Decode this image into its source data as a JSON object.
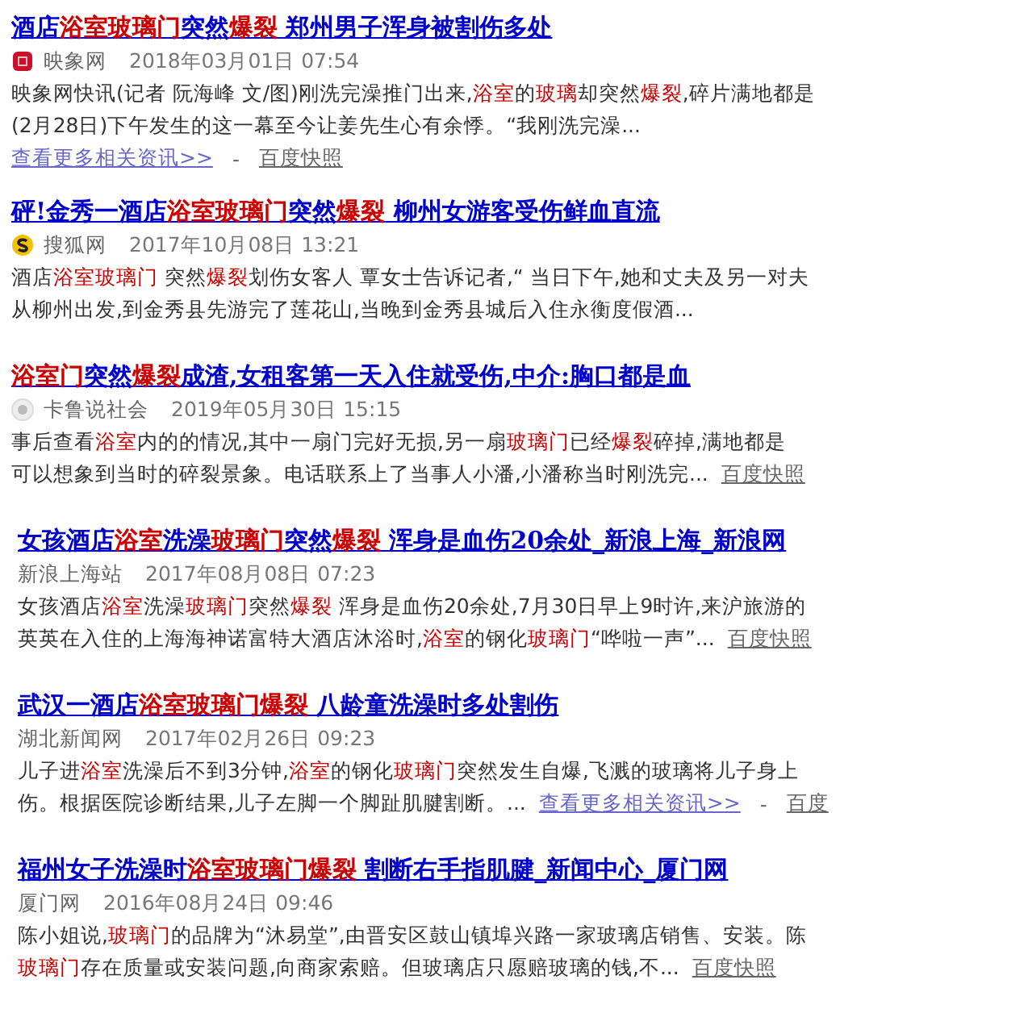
{
  "results": [
    {
      "title": [
        {
          "text": "酒店",
          "highlight": false
        },
        {
          "text": "浴室玻璃门",
          "highlight": true
        },
        {
          "text": "突然",
          "highlight": false
        },
        {
          "text": "爆裂",
          "highlight": true
        },
        {
          "text": " 郑州男子浑身被割伤多处",
          "highlight": false
        }
      ],
      "logo": {
        "kind": "square"
      },
      "source": "映象网",
      "date": "2018年03月01日 07:54",
      "lines": [
        {
          "segments": [
            {
              "text": "映象网快讯(记者 阮海峰 文/图)刚洗完澡推门出来,",
              "highlight": false
            },
            {
              "text": "浴室",
              "highlight": true
            },
            {
              "text": "的",
              "highlight": false
            },
            {
              "text": "玻璃",
              "highlight": true
            },
            {
              "text": "却突然",
              "highlight": false
            },
            {
              "text": "爆裂",
              "highlight": true
            },
            {
              "text": ",碎片满地都是",
              "highlight": false
            }
          ]
        },
        {
          "segments": [
            {
              "text": "(2月28日)下午发生的这一幕至今让姜先生心有余悸。“我刚洗完澡...",
              "highlight": false
            }
          ]
        },
        {
          "links": [
            {
              "kind": "more",
              "text": "查看更多相关资讯>>"
            },
            {
              "kind": "sep",
              "text": "-"
            },
            {
              "kind": "cache",
              "text": "百度快照"
            }
          ]
        }
      ]
    },
    {
      "title": [
        {
          "text": "砰!金秀一酒店",
          "highlight": false
        },
        {
          "text": "浴室玻璃门",
          "highlight": true
        },
        {
          "text": "突然",
          "highlight": false
        },
        {
          "text": "爆裂",
          "highlight": true
        },
        {
          "text": " 柳州女游客受伤鲜血直流",
          "highlight": false
        }
      ],
      "logo": {
        "kind": "swirl"
      },
      "source": "搜狐网",
      "date": "2017年10月08日 13:21",
      "lines": [
        {
          "segments": [
            {
              "text": "酒店",
              "highlight": false
            },
            {
              "text": "浴室玻璃门",
              "highlight": true
            },
            {
              "text": " 突然",
              "highlight": false
            },
            {
              "text": "爆裂",
              "highlight": true
            },
            {
              "text": "划伤女客人 覃女士告诉记者,“ 当日下午,她和丈夫及另一对夫",
              "highlight": false
            }
          ]
        },
        {
          "segments": [
            {
              "text": "从柳州出发,到金秀县先游完了莲花山,当晚到金秀县城后入住永衡度假酒...",
              "highlight": false
            }
          ]
        }
      ]
    },
    {
      "title": [
        {
          "text": "浴室门",
          "highlight": true
        },
        {
          "text": "突然",
          "highlight": false
        },
        {
          "text": "爆裂",
          "highlight": true
        },
        {
          "text": "成渣,女租客第一天入住就受伤,中介:胸口都是血",
          "highlight": false
        }
      ],
      "logo": {
        "kind": "dot"
      },
      "source": "卡鲁说社会",
      "date": "2019年05月30日 15:15",
      "lines": [
        {
          "segments": [
            {
              "text": "事后查看",
              "highlight": false
            },
            {
              "text": "浴室",
              "highlight": true
            },
            {
              "text": "内的的情况,其中一扇门完好无损,另一扇",
              "highlight": false
            },
            {
              "text": "玻璃门",
              "highlight": true
            },
            {
              "text": "已经",
              "highlight": false
            },
            {
              "text": "爆裂",
              "highlight": true
            },
            {
              "text": "碎掉,满地都是",
              "highlight": false
            }
          ]
        },
        {
          "segments": [
            {
              "text": "可以想象到当时的碎裂景象。电话联系上了当事人小潘,小潘称当时刚洗完...",
              "highlight": false
            }
          ],
          "links": [
            {
              "kind": "cache",
              "text": "百度快照"
            }
          ]
        }
      ]
    },
    {
      "title": [
        {
          "text": "女孩酒店",
          "highlight": false
        },
        {
          "text": "浴室",
          "highlight": true
        },
        {
          "text": "洗澡",
          "highlight": false
        },
        {
          "text": "玻璃门",
          "highlight": true
        },
        {
          "text": "突然",
          "highlight": false
        },
        {
          "text": "爆裂",
          "highlight": true
        },
        {
          "text": " 浑身是血伤20余处_新浪上海_新浪网",
          "highlight": false
        }
      ],
      "source": "新浪上海站",
      "date": "2017年08月08日 07:23",
      "lines": [
        {
          "segments": [
            {
              "text": "女孩酒店",
              "highlight": false
            },
            {
              "text": "浴室",
              "highlight": true
            },
            {
              "text": "洗澡",
              "highlight": false
            },
            {
              "text": "玻璃门",
              "highlight": true
            },
            {
              "text": "突然",
              "highlight": false
            },
            {
              "text": "爆裂",
              "highlight": true
            },
            {
              "text": " 浑身是血伤20余处,7月30日早上9时许,来沪旅游的",
              "highlight": false
            }
          ]
        },
        {
          "segments": [
            {
              "text": "英英在入住的上海海神诺富特大酒店沐浴时,",
              "highlight": false
            },
            {
              "text": "浴室",
              "highlight": true
            },
            {
              "text": "的钢化",
              "highlight": false
            },
            {
              "text": "玻璃门",
              "highlight": true
            },
            {
              "text": "“哗啦一声”...",
              "highlight": false
            }
          ],
          "links": [
            {
              "kind": "cache",
              "text": "百度快照"
            }
          ]
        }
      ]
    },
    {
      "title": [
        {
          "text": "武汉一酒店",
          "highlight": false
        },
        {
          "text": "浴室玻璃门爆裂",
          "highlight": true
        },
        {
          "text": " 八龄童洗澡时多处割伤",
          "highlight": false
        }
      ],
      "source": "湖北新闻网",
      "date": "2017年02月26日 09:23",
      "lines": [
        {
          "segments": [
            {
              "text": "儿子进",
              "highlight": false
            },
            {
              "text": "浴室",
              "highlight": true
            },
            {
              "text": "洗澡后不到3分钟,",
              "highlight": false
            },
            {
              "text": "浴室",
              "highlight": true
            },
            {
              "text": "的钢化",
              "highlight": false
            },
            {
              "text": "玻璃门",
              "highlight": true
            },
            {
              "text": "突然发生自爆,飞溅的玻璃将儿子身上",
              "highlight": false
            }
          ]
        },
        {
          "segments": [
            {
              "text": "伤。根据医院诊断结果,儿子左脚一个脚趾肌腱割断。...",
              "highlight": false
            }
          ],
          "links": [
            {
              "kind": "more",
              "text": "查看更多相关资讯>>"
            },
            {
              "kind": "sep",
              "text": "-"
            },
            {
              "kind": "cache",
              "text": "百度"
            }
          ]
        }
      ]
    },
    {
      "title": [
        {
          "text": "福州女子洗澡时",
          "highlight": false
        },
        {
          "text": "浴室玻璃门爆裂",
          "highlight": true
        },
        {
          "text": " 割断右手指肌腱_新闻中心_厦门网",
          "highlight": false
        }
      ],
      "source": "厦门网",
      "date": "2016年08月24日 09:46",
      "lines": [
        {
          "segments": [
            {
              "text": "陈小姐说,",
              "highlight": false
            },
            {
              "text": "玻璃门",
              "highlight": true
            },
            {
              "text": "的品牌为“沐易堂”,由晋安区鼓山镇埠兴路一家玻璃店销售、安装。陈",
              "highlight": false
            }
          ]
        },
        {
          "segments": [
            {
              "text": "玻璃门",
              "highlight": true
            },
            {
              "text": "存在质量或安装问题,向商家索赔。但玻璃店只愿赔玻璃的钱,不...",
              "highlight": false
            }
          ],
          "links": [
            {
              "kind": "cache",
              "text": "百度快照"
            }
          ]
        }
      ]
    }
  ]
}
